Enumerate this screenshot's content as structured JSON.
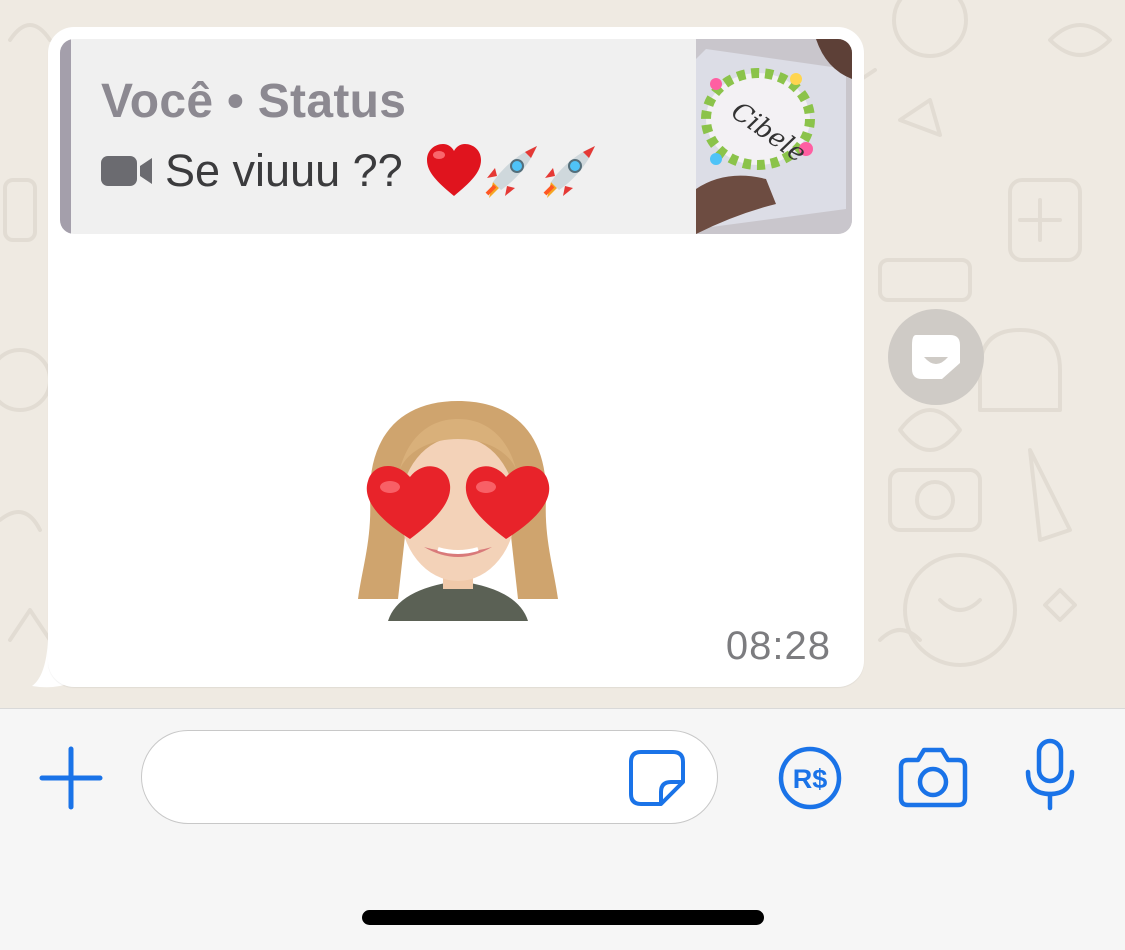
{
  "chat": {
    "message": {
      "quote": {
        "author": "Você • Status",
        "media_icon": "video-icon",
        "text": "Se viuuu ??",
        "emojis": [
          "red-heart-emoji",
          "rocket-emoji",
          "rocket-emoji"
        ],
        "thumbnail_text": "Cibele"
      },
      "sticker": "avatar-heart-eyes-sticker",
      "timestamp": "08:28"
    },
    "reaction_button_icon": "sticker-reply-icon"
  },
  "composer": {
    "input_value": "",
    "input_placeholder": "",
    "icons": [
      "plus-icon",
      "sticker-icon",
      "payment-icon",
      "camera-icon",
      "microphone-icon"
    ],
    "payment_label": "R$"
  },
  "colors": {
    "accent": "#1a73e8",
    "wallpaper": "#efeae2",
    "bubble": "#ffffff",
    "quote_bar": "#a49fab"
  }
}
